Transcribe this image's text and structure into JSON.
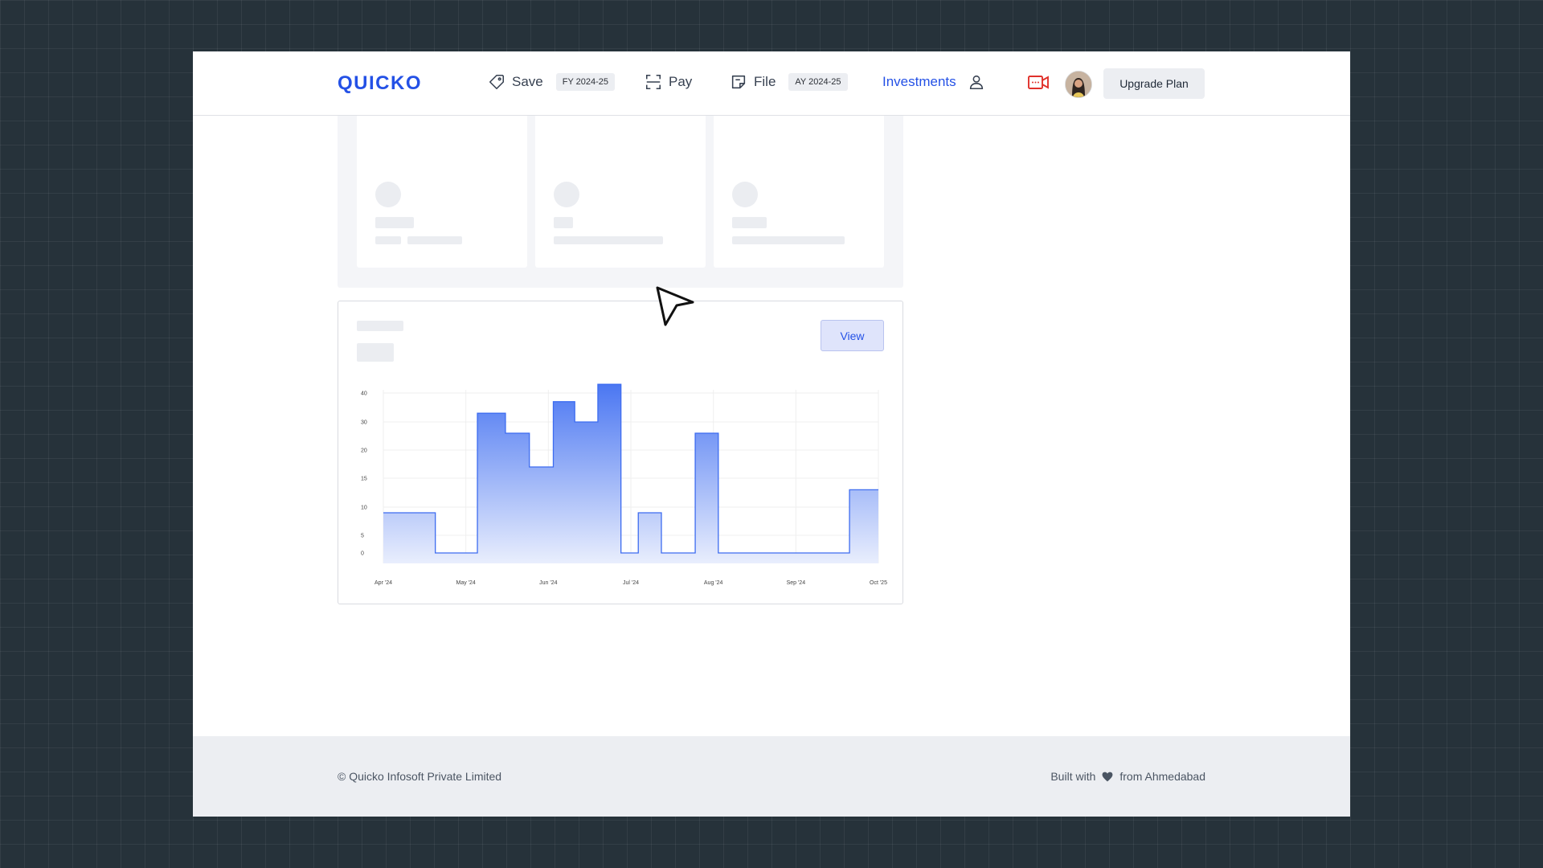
{
  "header": {
    "logo": "QUICKO",
    "nav": {
      "save": {
        "label": "Save",
        "badge": "FY 2024-25"
      },
      "pay": {
        "label": "Pay"
      },
      "file": {
        "label": "File",
        "badge": "AY 2024-25"
      },
      "investments": {
        "label": "Investments"
      }
    },
    "upgrade_label": "Upgrade Plan"
  },
  "chart_card": {
    "view_label": "View"
  },
  "chart_data": {
    "type": "area",
    "step": true,
    "x_ticks": [
      "Apr '24",
      "May '24",
      "Jun '24",
      "Jul '24",
      "Aug '24",
      "Sep '24",
      "Oct '25"
    ],
    "y_ticks": [
      0,
      5,
      10,
      15,
      20,
      30,
      40
    ],
    "ylim": [
      0,
      40
    ],
    "grid": true,
    "series": [
      {
        "color": "#3d6cf0",
        "points": [
          {
            "x": 0.0,
            "y": 9
          },
          {
            "x": 0.63,
            "y": 9
          },
          {
            "x": 0.63,
            "y": 0
          },
          {
            "x": 1.14,
            "y": 0
          },
          {
            "x": 1.14,
            "y": 33
          },
          {
            "x": 1.48,
            "y": 33
          },
          {
            "x": 1.48,
            "y": 26
          },
          {
            "x": 1.77,
            "y": 26
          },
          {
            "x": 1.77,
            "y": 17
          },
          {
            "x": 2.06,
            "y": 17
          },
          {
            "x": 2.06,
            "y": 37
          },
          {
            "x": 2.32,
            "y": 37
          },
          {
            "x": 2.32,
            "y": 30
          },
          {
            "x": 2.6,
            "y": 30
          },
          {
            "x": 2.6,
            "y": 43
          },
          {
            "x": 2.88,
            "y": 43
          },
          {
            "x": 2.88,
            "y": 0
          },
          {
            "x": 3.09,
            "y": 0
          },
          {
            "x": 3.09,
            "y": 9
          },
          {
            "x": 3.37,
            "y": 9
          },
          {
            "x": 3.37,
            "y": 0
          },
          {
            "x": 3.78,
            "y": 0
          },
          {
            "x": 3.78,
            "y": 26
          },
          {
            "x": 4.06,
            "y": 26
          },
          {
            "x": 4.06,
            "y": 0
          },
          {
            "x": 5.65,
            "y": 0
          },
          {
            "x": 5.65,
            "y": 13
          },
          {
            "x": 6.0,
            "y": 13
          }
        ]
      }
    ]
  },
  "footer": {
    "left": "© Quicko Infosoft Private Limited",
    "right_prefix": "Built with",
    "right_suffix": "from Ahmedabad"
  }
}
